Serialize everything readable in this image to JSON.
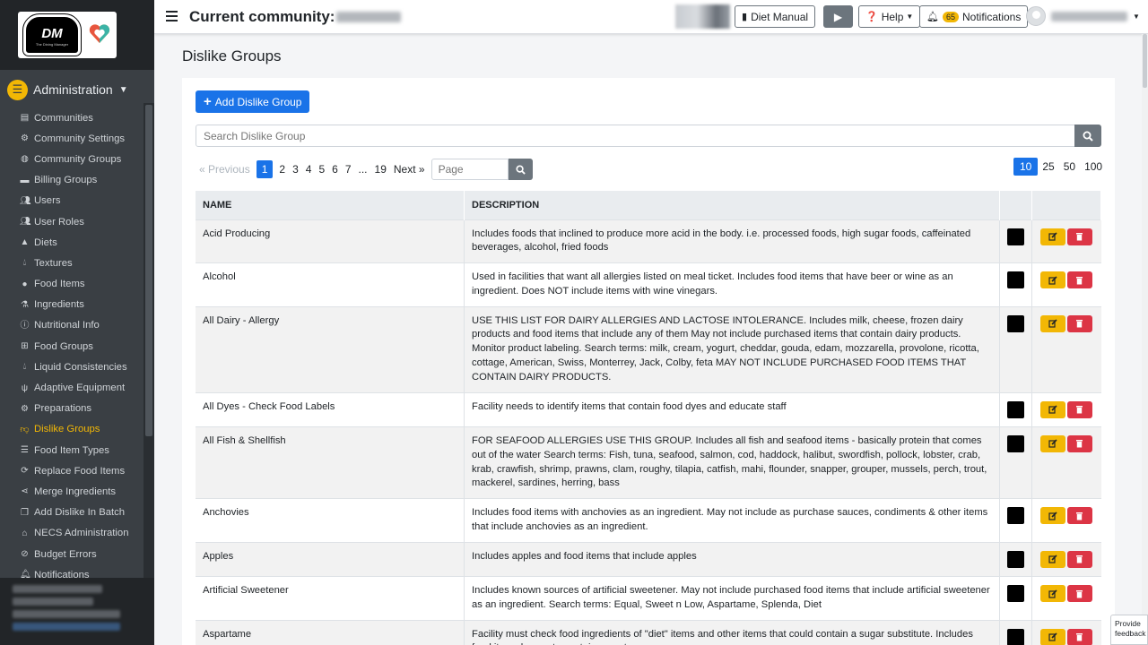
{
  "sidebar": {
    "section_label": "Administration",
    "items": [
      {
        "label": "Communities",
        "icon": "file-icon"
      },
      {
        "label": "Community Settings",
        "icon": "gear-icon"
      },
      {
        "label": "Community Groups",
        "icon": "globe-icon"
      },
      {
        "label": "Billing Groups",
        "icon": "money-icon"
      },
      {
        "label": "Users",
        "icon": "users-icon"
      },
      {
        "label": "User Roles",
        "icon": "users-cog-icon"
      },
      {
        "label": "Diets",
        "icon": "warning-icon"
      },
      {
        "label": "Textures",
        "icon": "drop-icon"
      },
      {
        "label": "Food Items",
        "icon": "apple-icon"
      },
      {
        "label": "Ingredients",
        "icon": "flask-icon"
      },
      {
        "label": "Nutritional Info",
        "icon": "info-icon"
      },
      {
        "label": "Food Groups",
        "icon": "sitemap-icon"
      },
      {
        "label": "Liquid Consistencies",
        "icon": "drop-icon"
      },
      {
        "label": "Adaptive Equipment",
        "icon": "utensils-icon"
      },
      {
        "label": "Preparations",
        "icon": "gears-icon"
      },
      {
        "label": "Dislike Groups",
        "icon": "thumbs-down-icon"
      },
      {
        "label": "Food Item Types",
        "icon": "list-icon"
      },
      {
        "label": "Replace Food Items",
        "icon": "sync-icon"
      },
      {
        "label": "Merge Ingredients",
        "icon": "share-icon"
      },
      {
        "label": "Add Dislike In Batch",
        "icon": "copy-icon"
      },
      {
        "label": "NECS Administration",
        "icon": "bank-icon"
      },
      {
        "label": "Budget Errors",
        "icon": "error-icon"
      },
      {
        "label": "Notifications",
        "icon": "bell-icon"
      }
    ]
  },
  "topbar": {
    "title": "Current community:",
    "diet_manual": "Diet Manual",
    "help": "Help",
    "notifications_count": "65",
    "notifications": "Notifications"
  },
  "page": {
    "title": "Dislike Groups",
    "add_button": "Add Dislike Group",
    "search_placeholder": "Search Dislike Group"
  },
  "pagination": {
    "previous": "« Previous",
    "pages": [
      "1",
      "2",
      "3",
      "4",
      "5",
      "6",
      "7",
      "...",
      "19"
    ],
    "active_page": "1",
    "next": "Next »",
    "page_placeholder": "Page",
    "per_page": [
      "10",
      "25",
      "50",
      "100"
    ],
    "active_per_page": "10"
  },
  "table": {
    "headers": [
      "NAME",
      "DESCRIPTION"
    ],
    "rows": [
      {
        "name": "Acid Producing",
        "description": "Includes foods that inclined to produce more acid in the body. i.e. processed foods, high sugar foods, caffeinated beverages, alcohol, fried foods",
        "color": "#000000"
      },
      {
        "name": "Alcohol",
        "description": "Used in facilities that want all allergies listed on meal ticket. Includes food items that have beer or wine as an ingredient. Does NOT include items with wine vinegars.",
        "color": "#000000"
      },
      {
        "name": "All Dairy - Allergy",
        "description": "USE THIS LIST FOR DAIRY ALLERGIES AND LACTOSE INTOLERANCE. Includes milk, cheese, frozen dairy products and food items that include any of them May not include purchased items that contain dairy products. Monitor product labeling. Search terms: milk, cream, yogurt, cheddar, gouda, edam, mozzarella, provolone, ricotta, cottage, American, Swiss, Monterrey, Jack, Colby, feta MAY NOT INCLUDE PURCHASED FOOD ITEMS THAT CONTAIN DAIRY PRODUCTS.",
        "color": "#000000"
      },
      {
        "name": "All Dyes - Check Food Labels",
        "description": "Facility needs to identify items that contain food dyes and educate staff",
        "color": "#000000"
      },
      {
        "name": "All Fish & Shellfish",
        "description": "FOR SEAFOOD ALLERGIES USE THIS GROUP. Includes all fish and seafood items - basically protein that comes out of the water Search terms: Fish, tuna, seafood, salmon, cod, haddock, halibut, swordfish, pollock, lobster, crab, krab, crawfish, shrimp, prawns, clam, roughy, tilapia, catfish, mahi, flounder, snapper, grouper, mussels, perch, trout, mackerel, sardines, herring, bass",
        "color": "#000000"
      },
      {
        "name": "Anchovies",
        "description": "Includes food items with anchovies as an ingredient. May not include as purchase sauces, condiments & other items that include anchovies as an ingredient.",
        "color": "#000000"
      },
      {
        "name": "Apples",
        "description": "Includes apples and food items that include apples",
        "color": "#000000"
      },
      {
        "name": "Artificial Sweetener",
        "description": "Includes known sources of artificial sweetener. May not include purchased food items that include artificial sweetener as an ingredient. Search terms: Equal, Sweet n Low, Aspartame, Splenda, Diet",
        "color": "#000000"
      },
      {
        "name": "Aspartame",
        "description": "Facility must check food ingredients of \"diet\" items and other items that could contain a sugar substitute. Includes food items known to contain aspartame",
        "color": "#000000"
      }
    ]
  },
  "feedback": {
    "line1": "Provide",
    "line2": "feedback"
  },
  "colors": {
    "accent": "#1a73e8",
    "sidebar": "#3a3f44",
    "active": "#f2b705",
    "edit": "#f2b705",
    "delete": "#dc3545"
  }
}
